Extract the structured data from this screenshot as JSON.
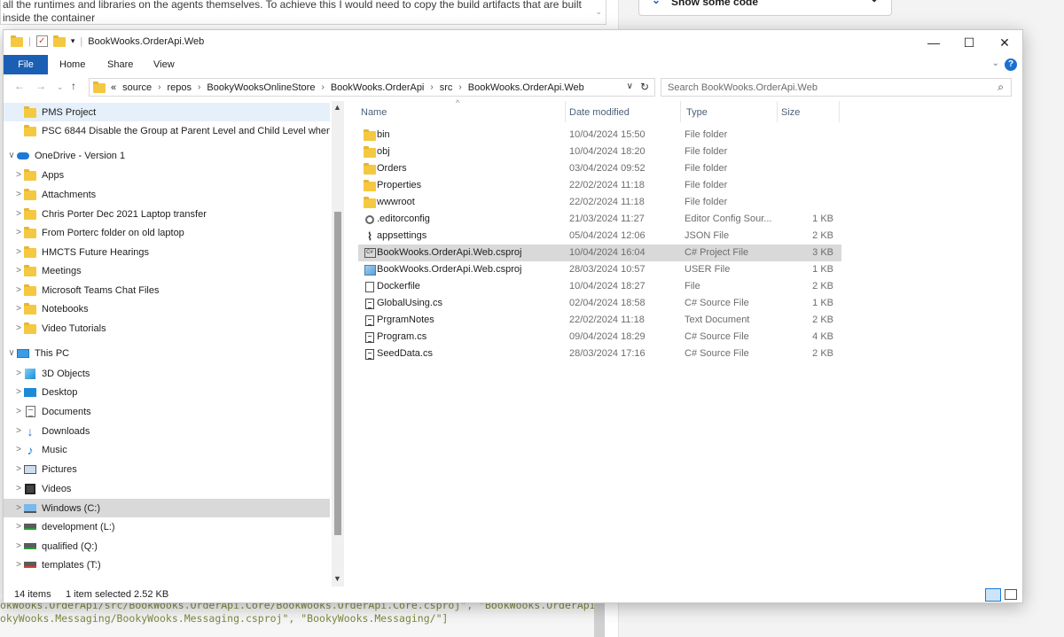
{
  "background": {
    "question_lines": [
      "all the runtimes and libraries on the agents themselves. To achieve this I would need to copy the build artifacts that are built",
      "inside the container"
    ],
    "dropdown_label": "Show some code",
    "code_lines": [
      "okWooks.OrderApi/src/BookWooks.OrderApi.Core/BookWooks.OrderApi.Core.csproj\", \"BookWooks.OrderApi/",
      "okyWooks.Messaging/BookyWooks.Messaging.csproj\", \"BookyWooks.Messaging/\"]",
      ""
    ]
  },
  "window": {
    "title": "BookWooks.OrderApi.Web",
    "controls": {
      "minimize": "—",
      "maximize": "☐",
      "close": "✕"
    }
  },
  "ribbon": {
    "file": "File",
    "tabs": [
      "Home",
      "Share",
      "View"
    ],
    "help": "?"
  },
  "address": {
    "overflow": "«",
    "crumbs": [
      "source",
      "repos",
      "BookyWooksOnlineStore",
      "BookWooks.OrderApi",
      "src",
      "BookWooks.OrderApi.Web"
    ],
    "search_placeholder": "Search BookWooks.OrderApi.Web"
  },
  "nav_pane": {
    "items": [
      {
        "label": "PMS Project",
        "icon": "folder-icon",
        "indent": 1,
        "expander": ""
      },
      {
        "label": "PSC 6844 Disable the Group at Parent Level and Child Level when Va",
        "icon": "folder-icon",
        "indent": 1,
        "expander": ""
      },
      {
        "label": "OneDrive - Version 1",
        "icon": "cloud-icon",
        "indent": 0,
        "expander": "∨"
      },
      {
        "label": "Apps",
        "icon": "folder-icon",
        "indent": 1,
        "expander": ">"
      },
      {
        "label": "Attachments",
        "icon": "folder-icon",
        "indent": 1,
        "expander": ">"
      },
      {
        "label": "Chris Porter Dec 2021 Laptop transfer",
        "icon": "folder-icon",
        "indent": 1,
        "expander": ">"
      },
      {
        "label": "From Porterc folder on old laptop",
        "icon": "folder-icon",
        "indent": 1,
        "expander": ">"
      },
      {
        "label": "HMCTS Future Hearings",
        "icon": "folder-icon",
        "indent": 1,
        "expander": ">"
      },
      {
        "label": "Meetings",
        "icon": "folder-icon",
        "indent": 1,
        "expander": ">"
      },
      {
        "label": "Microsoft Teams Chat Files",
        "icon": "folder-icon",
        "indent": 1,
        "expander": ">"
      },
      {
        "label": "Notebooks",
        "icon": "folder-icon",
        "indent": 1,
        "expander": ">"
      },
      {
        "label": "Video Tutorials",
        "icon": "folder-icon",
        "indent": 1,
        "expander": ">"
      },
      {
        "label": "This PC",
        "icon": "pc-icon",
        "indent": 0,
        "expander": "∨"
      },
      {
        "label": "3D Objects",
        "icon": "cube-icon",
        "indent": 1,
        "expander": ">"
      },
      {
        "label": "Desktop",
        "icon": "desktop-icon",
        "indent": 1,
        "expander": ">"
      },
      {
        "label": "Documents",
        "icon": "documents-icon",
        "indent": 1,
        "expander": ">"
      },
      {
        "label": "Downloads",
        "icon": "downloads-icon",
        "indent": 1,
        "expander": ">"
      },
      {
        "label": "Music",
        "icon": "music-icon",
        "indent": 1,
        "expander": ">"
      },
      {
        "label": "Pictures",
        "icon": "pictures-icon",
        "indent": 1,
        "expander": ">"
      },
      {
        "label": "Videos",
        "icon": "videos-icon",
        "indent": 1,
        "expander": ">"
      },
      {
        "label": "Windows (C:)",
        "icon": "windows-drive-icon",
        "indent": 1,
        "expander": ">"
      },
      {
        "label": "development (L:)",
        "icon": "network-drive-icon",
        "indent": 1,
        "expander": ">"
      },
      {
        "label": "qualified (Q:)",
        "icon": "network-drive-icon",
        "indent": 1,
        "expander": ">"
      },
      {
        "label": "templates (T:)",
        "icon": "disconnected-drive-icon",
        "indent": 1,
        "expander": ">"
      }
    ]
  },
  "file_list": {
    "columns": [
      "Name",
      "Date modified",
      "Type",
      "Size"
    ],
    "rows": [
      {
        "name": "bin",
        "date": "10/04/2024 15:50",
        "type": "File folder",
        "size": "",
        "icon": "folder-icon"
      },
      {
        "name": "obj",
        "date": "10/04/2024 18:20",
        "type": "File folder",
        "size": "",
        "icon": "folder-icon"
      },
      {
        "name": "Orders",
        "date": "03/04/2024 09:52",
        "type": "File folder",
        "size": "",
        "icon": "folder-icon"
      },
      {
        "name": "Properties",
        "date": "22/02/2024 11:18",
        "type": "File folder",
        "size": "",
        "icon": "folder-icon"
      },
      {
        "name": "wwwroot",
        "date": "22/02/2024 11:18",
        "type": "File folder",
        "size": "",
        "icon": "folder-icon"
      },
      {
        "name": ".editorconfig",
        "date": "21/03/2024 11:27",
        "type": "Editor Config Sour...",
        "size": "1 KB",
        "icon": "config-icon"
      },
      {
        "name": "appsettings",
        "date": "05/04/2024 12:06",
        "type": "JSON File",
        "size": "2 KB",
        "icon": "json-icon"
      },
      {
        "name": "BookWooks.OrderApi.Web.csproj",
        "date": "10/04/2024 16:04",
        "type": "C# Project File",
        "size": "3 KB",
        "icon": "csproj-icon",
        "selected": true
      },
      {
        "name": "BookWooks.OrderApi.Web.csproj",
        "date": "28/03/2024 10:57",
        "type": "USER File",
        "size": "1 KB",
        "icon": "user-file-icon"
      },
      {
        "name": "Dockerfile",
        "date": "10/04/2024 18:27",
        "type": "File",
        "size": "2 KB",
        "icon": "blank-file-icon"
      },
      {
        "name": "GlobalUsing.cs",
        "date": "02/04/2024 18:58",
        "type": "C# Source File",
        "size": "1 KB",
        "icon": "cs-file-icon"
      },
      {
        "name": "PrgramNotes",
        "date": "22/02/2024 11:18",
        "type": "Text Document",
        "size": "2 KB",
        "icon": "text-file-icon"
      },
      {
        "name": "Program.cs",
        "date": "09/04/2024 18:29",
        "type": "C# Source File",
        "size": "4 KB",
        "icon": "cs-file-icon"
      },
      {
        "name": "SeedData.cs",
        "date": "28/03/2024 17:16",
        "type": "C# Source File",
        "size": "2 KB",
        "icon": "cs-file-icon"
      }
    ]
  },
  "status": {
    "items": "14 items",
    "selection": "1 item selected  2.52 KB"
  },
  "colors": {
    "accent": "#1a5fb4",
    "selection": "#d9d9d9",
    "hover": "#e5f0fb",
    "folder": "#f5c842"
  }
}
